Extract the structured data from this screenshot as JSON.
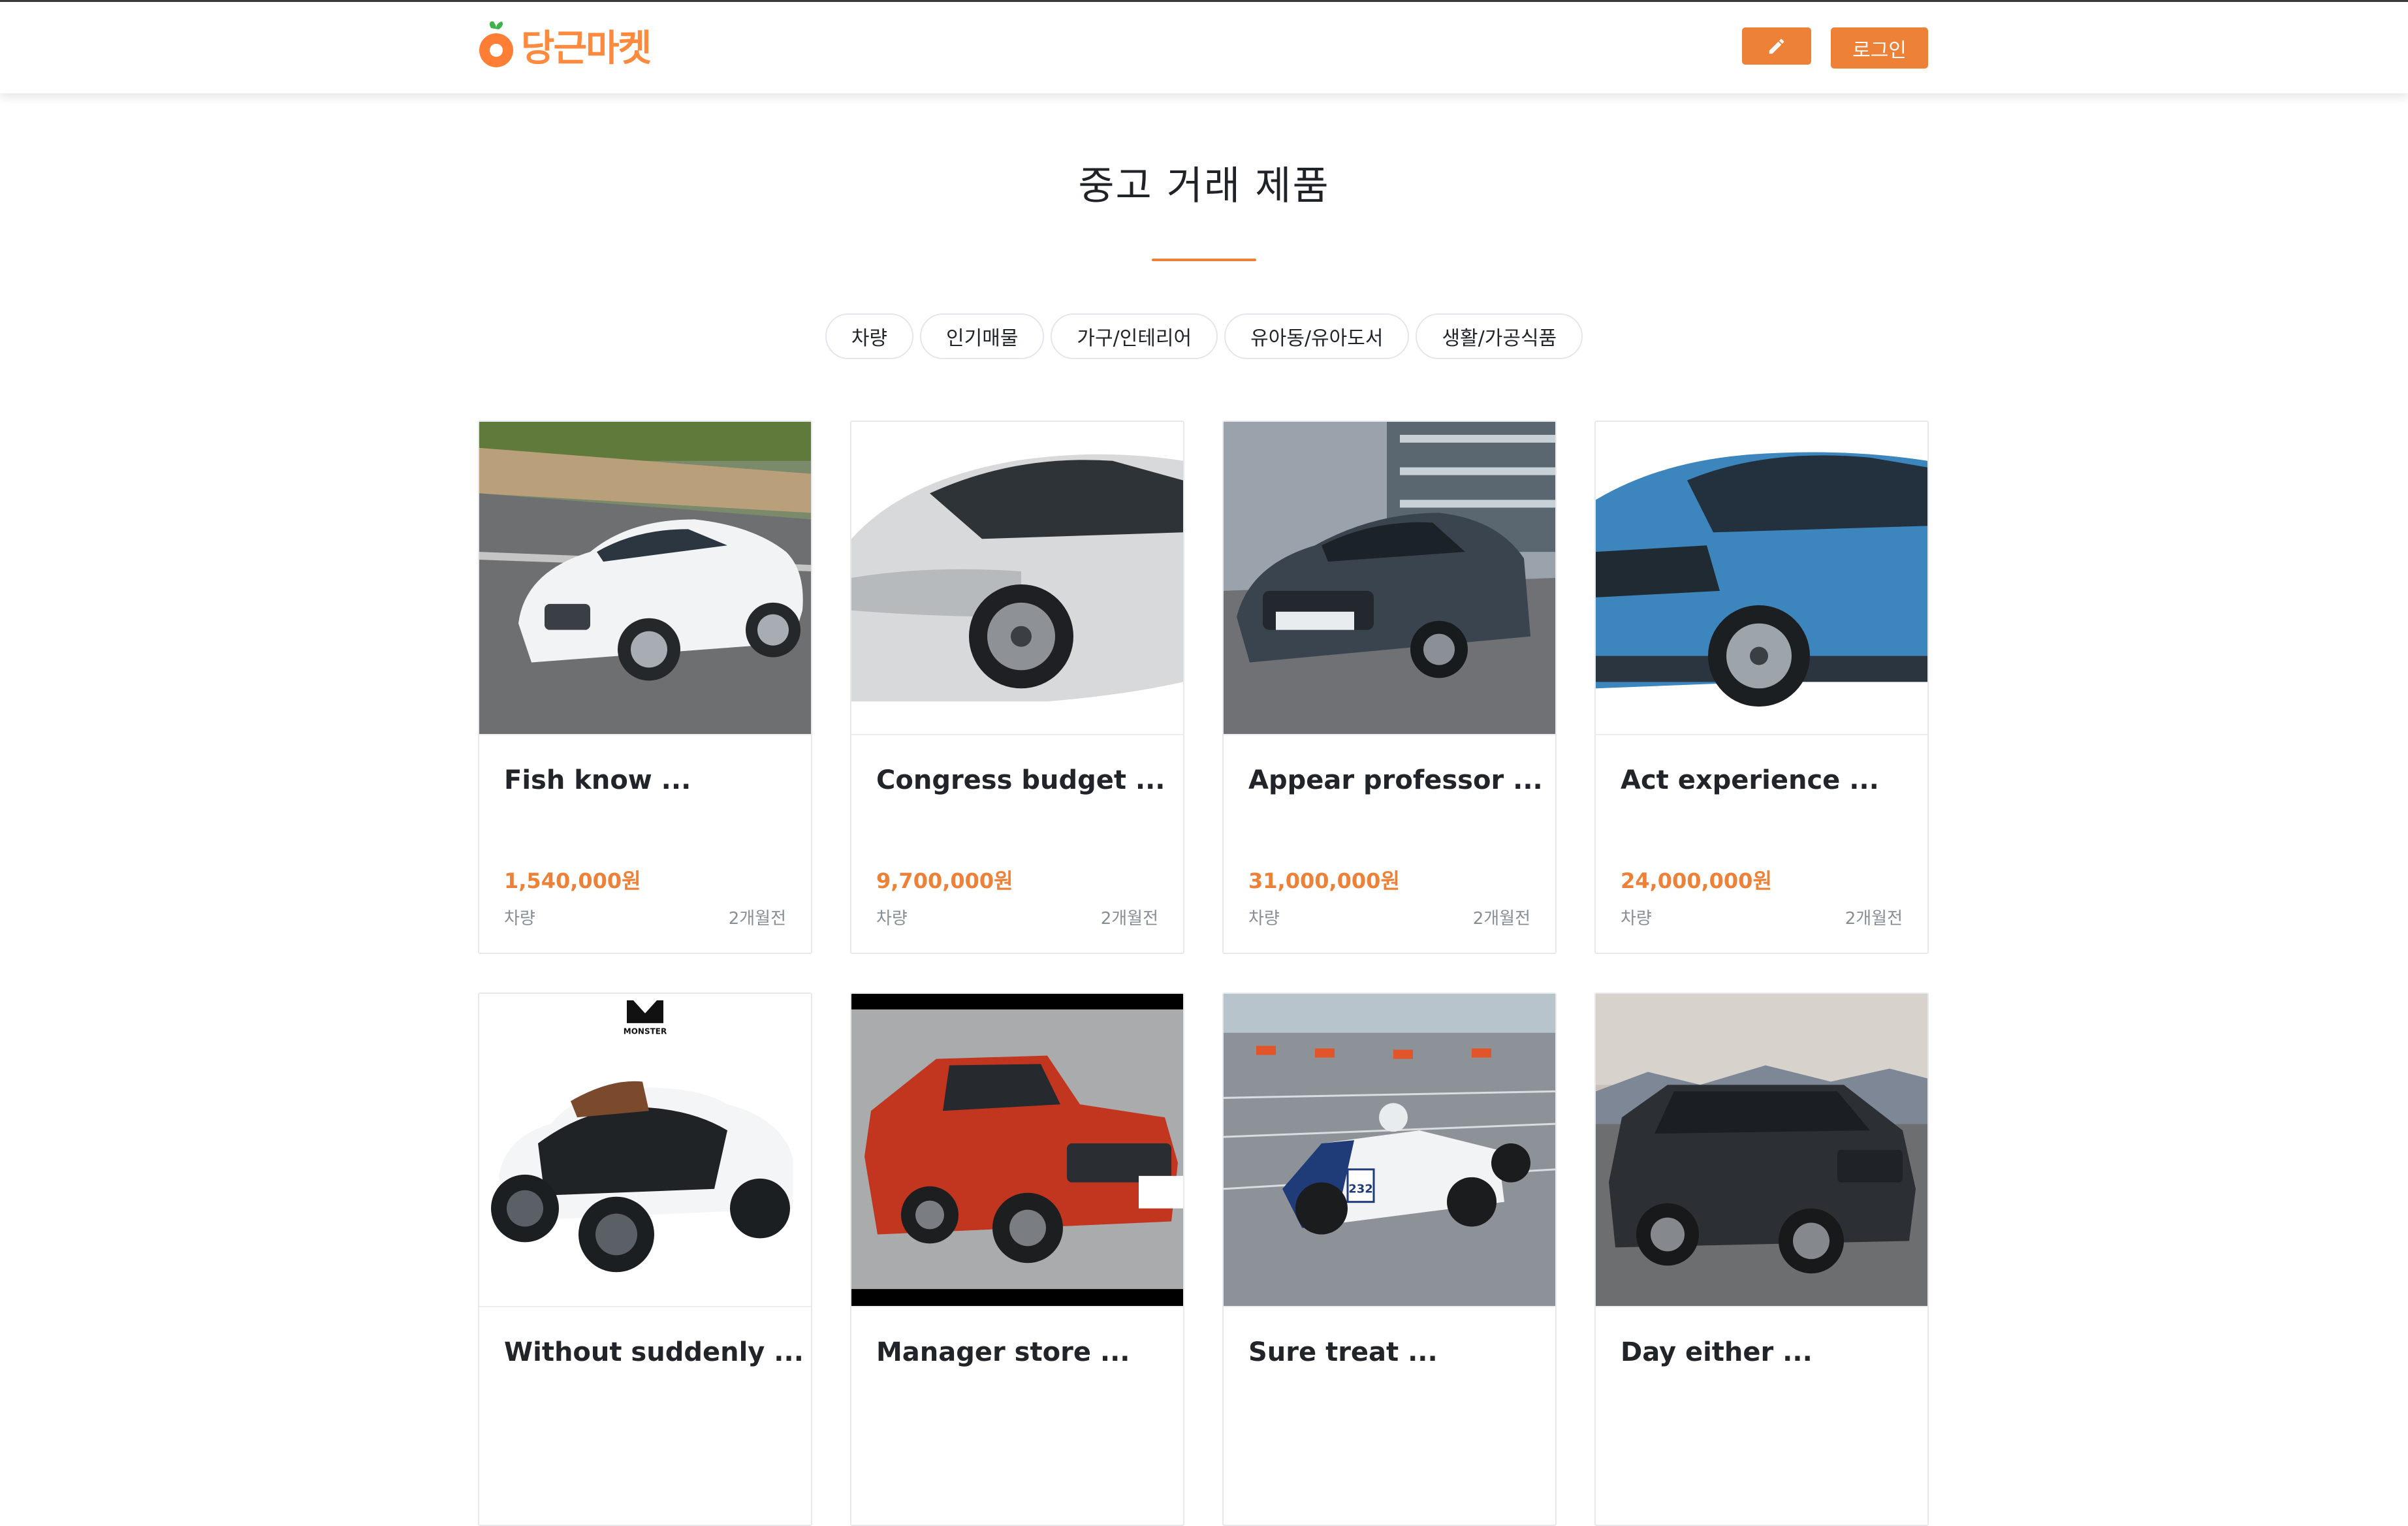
{
  "header": {
    "logo_text": "당근마켓",
    "write_icon": "pencil-icon",
    "login_label": "로그인",
    "accent_color": "#ee8138"
  },
  "main": {
    "title": "중고 거래 제품",
    "categories": [
      {
        "label": "차량"
      },
      {
        "label": "인기매물"
      },
      {
        "label": "가구/인테리어"
      },
      {
        "label": "유아동/유아도서"
      },
      {
        "label": "생활/가공식품"
      }
    ],
    "products": [
      {
        "name": "Fish know ...",
        "price": "1,540,000원",
        "category": "차량",
        "date": "2개월전",
        "image": "white-sedan-image"
      },
      {
        "name": "Congress budget ...",
        "price": "9,700,000원",
        "category": "차량",
        "date": "2개월전",
        "image": "silver-sedan-image"
      },
      {
        "name": "Appear professor ...",
        "price": "31,000,000원",
        "category": "차량",
        "date": "2개월전",
        "image": "dark-sedan-image"
      },
      {
        "name": "Act experience ...",
        "price": "24,000,000원",
        "category": "차량",
        "date": "2개월전",
        "image": "blue-suv-image"
      },
      {
        "name": "Without suddenly ...",
        "image": "toy-car-image",
        "brand_mark": "MONSTER"
      },
      {
        "name": "Manager store ...",
        "image": "red-pickup-image"
      },
      {
        "name": "Sure treat ...",
        "image": "race-car-image",
        "race_number": "232"
      },
      {
        "name": "Day either ...",
        "image": "black-suv-image"
      }
    ]
  }
}
